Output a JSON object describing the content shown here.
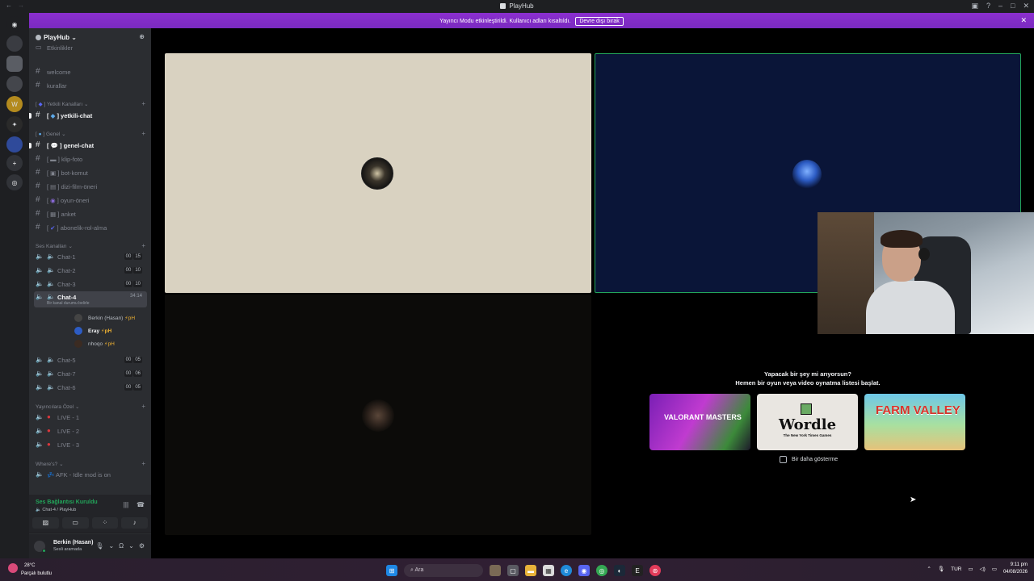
{
  "window": {
    "title": "PlayHub"
  },
  "banner": {
    "message": "Yayıncı Modu etkinleştirildi. Kullanıcı adları kısaltıldı.",
    "button": "Devre dışı bırak"
  },
  "server": {
    "name": "PlayHub"
  },
  "channels": {
    "top_partial": "Etkinlikler",
    "welcome": "welcome",
    "kurallar": "kurallar",
    "cat_yetkili": "Yetkili Kanalları",
    "yetkili_chat": "yetkili-chat",
    "cat_genel": "Genel",
    "genel_chat": "genel-chat",
    "klip_foto": "klip-foto",
    "bot_komut": "bot-komut",
    "dizi_film": "dizi-film-öneri",
    "oyun_oneri": "oyun-öneri",
    "anket": "anket",
    "abonelik": "abonelik-rol-alma",
    "cat_ses": "Ses Kanalları",
    "chat1": {
      "name": "Chat-1",
      "count": "00",
      "limit": "15"
    },
    "chat2": {
      "name": "Chat-2",
      "count": "00",
      "limit": "10"
    },
    "chat3": {
      "name": "Chat-3",
      "count": "00",
      "limit": "10"
    },
    "chat4": {
      "name": "Chat-4",
      "time": "34:14",
      "sub": "Bir kanal durumu belirle"
    },
    "members": [
      {
        "name": "Berkin (Hasan)"
      },
      {
        "name": "Eray"
      },
      {
        "name": "nhoqo"
      }
    ],
    "chat5": {
      "name": "Chat-5",
      "count": "00",
      "limit": "05"
    },
    "chat7": {
      "name": "Chat-7",
      "count": "00",
      "limit": "06"
    },
    "chat6": {
      "name": "Chat-6",
      "count": "00",
      "limit": "05"
    },
    "cat_yayinci": "Yayıncılara Özel",
    "live1": "LIVE - 1",
    "live2": "LIVE - 2",
    "live3": "LIVE - 3",
    "cat_where": "Where's?",
    "afk": "AFK - Idle mod is on"
  },
  "voice_panel": {
    "status": "Ses Bağlantısı Kuruldu",
    "location": "Chat-4 / PlayHub"
  },
  "user_panel": {
    "name": "Berkin (Hasan)",
    "status": "Sesli aramada"
  },
  "activity": {
    "line1": "Yapacak bir şey mi arıyorsun?",
    "line2": "Hemen bir oyun veya video oynatma listesi başlat.",
    "card1_label": "VALORANT MASTERS",
    "card2_label": "Wordle",
    "card2_sub": "The New York Times Games",
    "card3_label": "FARM VALLEY",
    "dont_show": "Bir daha gösterme"
  },
  "taskbar": {
    "temp": "28°C",
    "weather": "Parçalı bulutlu",
    "search": "Ara",
    "lang": "TUR",
    "time": "9:11 pm",
    "date": "04/08/2026"
  },
  "colors": {
    "accent_banner": "#8b2fcf",
    "online_green": "#23a55a"
  }
}
